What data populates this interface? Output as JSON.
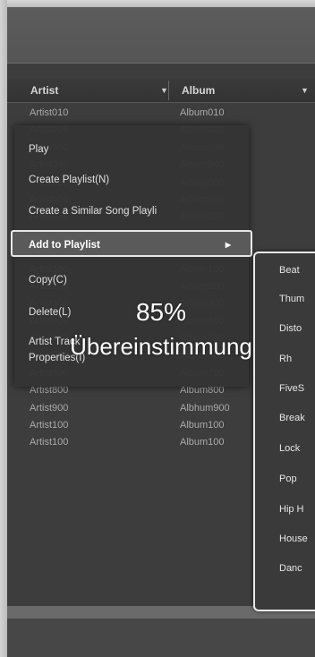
{
  "table": {
    "columns": [
      "Artist",
      "Album"
    ],
    "sort_glyph": "▼",
    "rows": [
      [
        "Artist010",
        "Album010"
      ],
      [
        "Artist020",
        "Album020"
      ],
      [
        "Artist030",
        "Album030"
      ],
      [
        "Artist040",
        "Album040"
      ],
      [
        "Artist050",
        "Album050"
      ],
      [
        "Artist060",
        "Album060"
      ],
      [
        "Artist070",
        "Album070"
      ],
      [
        "Artist080",
        "Album080"
      ],
      [
        "Artist090",
        "Album090"
      ],
      [
        "Artist100",
        "Album100"
      ],
      [
        "Artist200",
        "Album200"
      ],
      [
        "Artist300",
        "Album300"
      ],
      [
        "Artist400",
        "Album400"
      ],
      [
        "Artist500",
        "Album500"
      ],
      [
        "Artist600",
        "Album600"
      ],
      [
        "Artist700",
        "Album700"
      ],
      [
        "Artist800",
        "Album800"
      ],
      [
        "Artist900",
        "Albhum900"
      ],
      [
        "Artist100",
        "Album100"
      ],
      [
        "Artist100",
        "Album100"
      ]
    ]
  },
  "context_menu": {
    "items": [
      {
        "label": "Play"
      },
      {
        "label": "Create Playlist(N)"
      },
      {
        "label": "Create a Similar Song Playli"
      },
      {
        "label": "Add to Playlist",
        "selected": true,
        "submenu_arrow": "▶"
      },
      {
        "label": "Copy(C)"
      },
      {
        "label": "Delete(L)"
      },
      {
        "label": "Artist Track"
      },
      {
        "label": "Properties(I)"
      }
    ]
  },
  "submenu": {
    "items": [
      "Beat",
      "Thum",
      "Disto",
      "Rh",
      "FiveS",
      "Break",
      "Lock",
      "Pop",
      "Hip H",
      "House",
      "Danc"
    ]
  },
  "overlay": {
    "match_percent": "85%",
    "match_label": "Übereinstimmung"
  }
}
